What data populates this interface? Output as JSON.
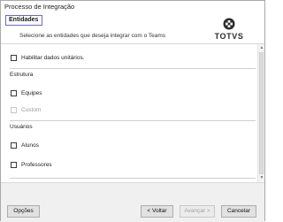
{
  "window": {
    "title": "Processo de Integração"
  },
  "header": {
    "section": "Entidades",
    "subtitle": "Selecione as entidades que deseja integrar com o Teams",
    "logo_text": "TOTVS"
  },
  "options": {
    "enable_units": {
      "label": "Habilitar dados unitários.",
      "checked": false
    }
  },
  "groups": {
    "estrutura": {
      "label": "Estrutura",
      "items": [
        {
          "label": "Equipes",
          "checked": false,
          "enabled": true
        },
        {
          "label": "Custom",
          "checked": false,
          "enabled": false
        }
      ]
    },
    "usuarios": {
      "label": "Usuários",
      "items": [
        {
          "label": "Alunos",
          "checked": false,
          "enabled": true
        },
        {
          "label": "Professores",
          "checked": false,
          "enabled": true
        }
      ]
    }
  },
  "footer": {
    "options_label": "Opções",
    "back_label": "< Voltar",
    "next_label": "Avançar >",
    "cancel_label": "Cancelar"
  },
  "icons": {
    "logo": "totvs-logo-icon",
    "scroll_up": "scroll-up-arrow-icon",
    "scroll_down": "scroll-down-arrow-icon"
  }
}
